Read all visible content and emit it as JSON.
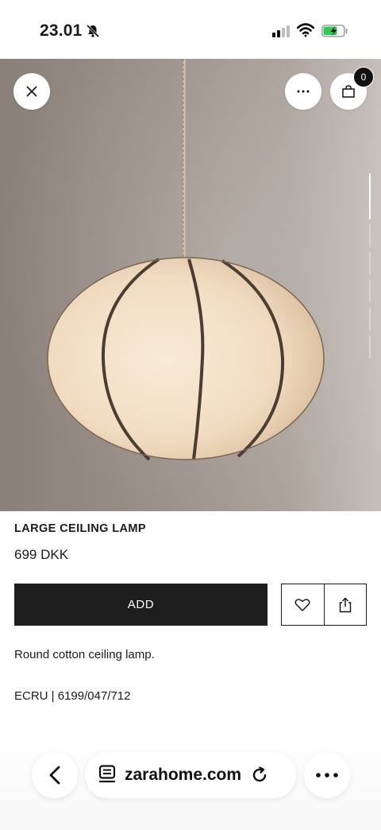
{
  "status_bar": {
    "time": "23.01",
    "icons": [
      "bell-slash-icon",
      "cellular-signal-icon",
      "wifi-icon",
      "battery-charging-icon"
    ],
    "battery_color": "#34c759"
  },
  "product_image": {
    "icons": [
      "close-icon",
      "more-icon",
      "shopping-bag-icon"
    ],
    "bag_count": "0"
  },
  "product": {
    "name": "LARGE CEILING LAMP",
    "price": "699 DKK",
    "add_label": "ADD",
    "description": "Round cotton ceiling lamp.",
    "color_ref": "ECRU | 6199/047/712",
    "action_icons": [
      "heart-icon",
      "share-icon"
    ]
  },
  "browser": {
    "url": "zarahome.com",
    "icons": [
      "back-icon",
      "page-icon",
      "reload-icon",
      "more-icon"
    ]
  },
  "colors": {
    "button_dark": "#1e1e1e",
    "text": "#1a1a1a"
  }
}
